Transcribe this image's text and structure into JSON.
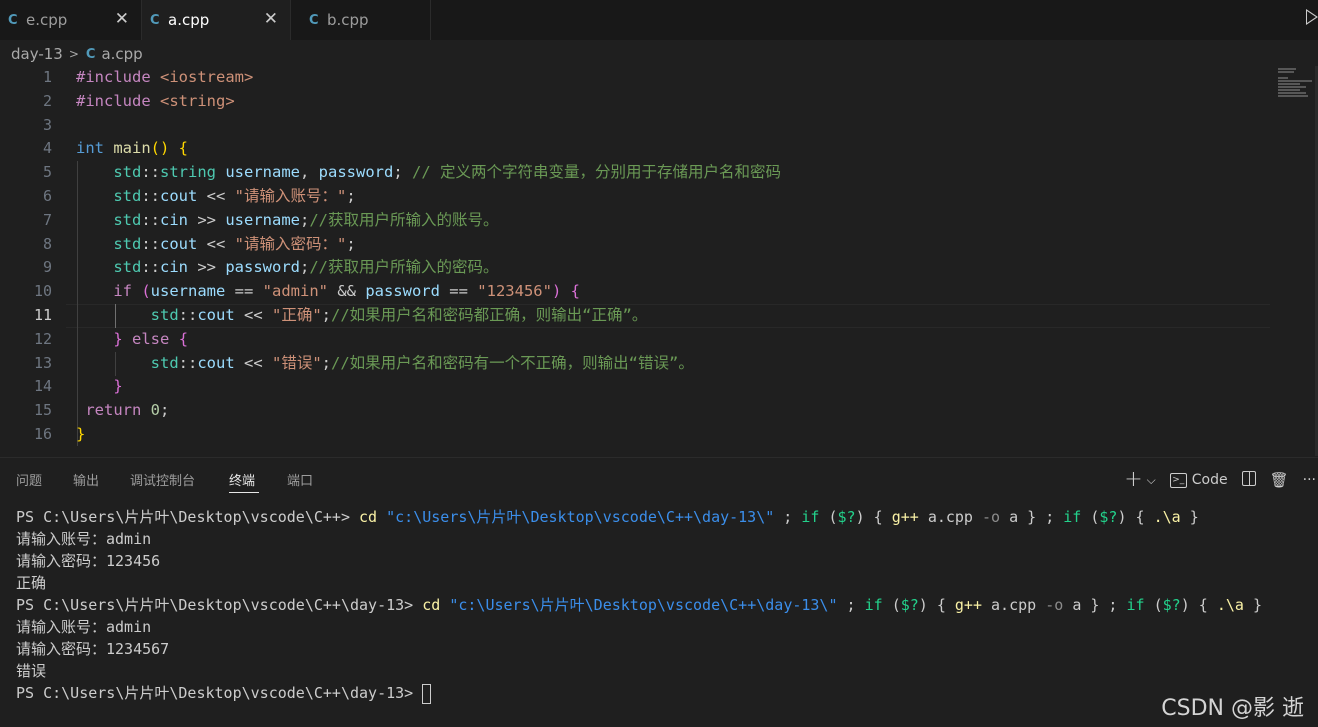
{
  "tabs": [
    {
      "icon": "C",
      "name": "e.cpp",
      "active": false
    },
    {
      "icon": "C",
      "name": "a.cpp",
      "active": true
    },
    {
      "icon": "C",
      "name": "b.cpp",
      "active": false
    }
  ],
  "tab_close_glyph": "✕",
  "breadcrumb": {
    "folder": "day-13",
    "separator": ">",
    "file": "a.cpp",
    "icon": "C"
  },
  "editor": {
    "line_numbers": [
      "1",
      "2",
      "3",
      "4",
      "5",
      "6",
      "7",
      "8",
      "9",
      "10",
      "11",
      "12",
      "13",
      "14",
      "15",
      "16"
    ],
    "current_line": "11",
    "lines": [
      [
        {
          "t": "#include ",
          "c": "k-inc"
        },
        {
          "t": "<iostream>",
          "c": "str"
        }
      ],
      [
        {
          "t": "#include ",
          "c": "k-inc"
        },
        {
          "t": "<string>",
          "c": "str"
        }
      ],
      [],
      [
        {
          "t": "int ",
          "c": "k-type"
        },
        {
          "t": "main",
          "c": "fn"
        },
        {
          "t": "() ",
          "c": "br1"
        },
        {
          "t": "{",
          "c": "br1"
        }
      ],
      [
        {
          "t": "    "
        },
        {
          "t": "std",
          "c": "ns"
        },
        {
          "t": "::"
        },
        {
          "t": "string",
          "c": "ns"
        },
        {
          "t": " "
        },
        {
          "t": "username",
          "c": "var"
        },
        {
          "t": ", "
        },
        {
          "t": "password",
          "c": "var"
        },
        {
          "t": "; "
        },
        {
          "t": "// 定义两个字符串变量，分别用于存储用户名和密码",
          "c": "cmt"
        }
      ],
      [
        {
          "t": "    "
        },
        {
          "t": "std",
          "c": "ns"
        },
        {
          "t": "::"
        },
        {
          "t": "cout",
          "c": "var"
        },
        {
          "t": " << "
        },
        {
          "t": "\"请输入账号：\"",
          "c": "str"
        },
        {
          "t": ";"
        }
      ],
      [
        {
          "t": "    "
        },
        {
          "t": "std",
          "c": "ns"
        },
        {
          "t": "::"
        },
        {
          "t": "cin",
          "c": "var"
        },
        {
          "t": " >> "
        },
        {
          "t": "username",
          "c": "var"
        },
        {
          "t": ";"
        },
        {
          "t": "//获取用户所输入的账号。",
          "c": "cmt"
        }
      ],
      [
        {
          "t": "    "
        },
        {
          "t": "std",
          "c": "ns"
        },
        {
          "t": "::"
        },
        {
          "t": "cout",
          "c": "var"
        },
        {
          "t": " << "
        },
        {
          "t": "\"请输入密码：\"",
          "c": "str"
        },
        {
          "t": ";"
        }
      ],
      [
        {
          "t": "    "
        },
        {
          "t": "std",
          "c": "ns"
        },
        {
          "t": "::"
        },
        {
          "t": "cin",
          "c": "var"
        },
        {
          "t": " >> "
        },
        {
          "t": "password",
          "c": "var"
        },
        {
          "t": ";"
        },
        {
          "t": "//获取用户所输入的密码。",
          "c": "cmt"
        }
      ],
      [
        {
          "t": "    "
        },
        {
          "t": "if ",
          "c": "k-ctrl"
        },
        {
          "t": "(",
          "c": "br2"
        },
        {
          "t": "username",
          "c": "var"
        },
        {
          "t": " == "
        },
        {
          "t": "\"admin\"",
          "c": "str"
        },
        {
          "t": " && "
        },
        {
          "t": "password",
          "c": "var"
        },
        {
          "t": " == "
        },
        {
          "t": "\"123456\"",
          "c": "str"
        },
        {
          "t": ")",
          "c": "br2"
        },
        {
          "t": " "
        },
        {
          "t": "{",
          "c": "br2"
        }
      ],
      [
        {
          "t": "        "
        },
        {
          "t": "std",
          "c": "ns"
        },
        {
          "t": "::"
        },
        {
          "t": "cout",
          "c": "var"
        },
        {
          "t": " << "
        },
        {
          "t": "\"正确\"",
          "c": "str"
        },
        {
          "t": ";"
        },
        {
          "t": "//如果用户名和密码都正确，则输出“正确”。",
          "c": "cmt"
        }
      ],
      [
        {
          "t": "    "
        },
        {
          "t": "}",
          "c": "br2"
        },
        {
          "t": " "
        },
        {
          "t": "else ",
          "c": "k-ctrl"
        },
        {
          "t": "{",
          "c": "br2"
        }
      ],
      [
        {
          "t": "        "
        },
        {
          "t": "std",
          "c": "ns"
        },
        {
          "t": "::"
        },
        {
          "t": "cout",
          "c": "var"
        },
        {
          "t": " << "
        },
        {
          "t": "\"错误\"",
          "c": "str"
        },
        {
          "t": ";"
        },
        {
          "t": "//如果用户名和密码有一个不正确，则输出“错误”。",
          "c": "cmt"
        }
      ],
      [
        {
          "t": "    "
        },
        {
          "t": "}",
          "c": "br2"
        }
      ],
      [
        {
          "t": " "
        },
        {
          "t": "return ",
          "c": "k-ctrl"
        },
        {
          "t": "0",
          "c": "num"
        },
        {
          "t": ";"
        }
      ],
      [
        {
          "t": "}",
          "c": "br1"
        }
      ]
    ]
  },
  "panel": {
    "tabs": [
      {
        "label": "问题",
        "active": false
      },
      {
        "label": "输出",
        "active": false
      },
      {
        "label": "调试控制台",
        "active": false
      },
      {
        "label": "终端",
        "active": true
      },
      {
        "label": "端口",
        "active": false
      }
    ],
    "actions": {
      "plus": "+",
      "dropdown": "⌵",
      "code_label": "Code",
      "more": "···"
    }
  },
  "terminal": {
    "lines": [
      [
        {
          "t": "PS C:\\Users\\片片叶\\Desktop\\vscode\\C++> "
        },
        {
          "t": "cd ",
          "c": "t-cmd"
        },
        {
          "t": "\"c:\\Users\\片片叶\\Desktop\\vscode\\C++\\day-13\\\"",
          "c": "t-str"
        },
        {
          "t": " ; "
        },
        {
          "t": "if ",
          "c": "t-kw"
        },
        {
          "t": "("
        },
        {
          "t": "$?",
          "c": "t-kw"
        },
        {
          "t": ") { "
        },
        {
          "t": "g++ ",
          "c": "t-cmd"
        },
        {
          "t": "a.cpp "
        },
        {
          "t": "-o ",
          "c": "t-op"
        },
        {
          "t": "a } ; "
        },
        {
          "t": "if ",
          "c": "t-kw"
        },
        {
          "t": "("
        },
        {
          "t": "$?",
          "c": "t-kw"
        },
        {
          "t": ") { "
        },
        {
          "t": ".\\a ",
          "c": "t-cmd"
        },
        {
          "t": "}"
        }
      ],
      [
        {
          "t": "请输入账号：admin"
        }
      ],
      [
        {
          "t": "请输入密码：123456"
        }
      ],
      [
        {
          "t": "正确"
        }
      ],
      [
        {
          "t": "PS C:\\Users\\片片叶\\Desktop\\vscode\\C++\\day-13> "
        },
        {
          "t": "cd ",
          "c": "t-cmd"
        },
        {
          "t": "\"c:\\Users\\片片叶\\Desktop\\vscode\\C++\\day-13\\\"",
          "c": "t-str"
        },
        {
          "t": " ; "
        },
        {
          "t": "if ",
          "c": "t-kw"
        },
        {
          "t": "("
        },
        {
          "t": "$?",
          "c": "t-kw"
        },
        {
          "t": ") { "
        },
        {
          "t": "g++ ",
          "c": "t-cmd"
        },
        {
          "t": "a.cpp "
        },
        {
          "t": "-o ",
          "c": "t-op"
        },
        {
          "t": "a } ; "
        },
        {
          "t": "if ",
          "c": "t-kw"
        },
        {
          "t": "("
        },
        {
          "t": "$?",
          "c": "t-kw"
        },
        {
          "t": ") { "
        },
        {
          "t": ".\\a ",
          "c": "t-cmd"
        },
        {
          "t": "}"
        }
      ],
      [
        {
          "t": "请输入账号：admin"
        }
      ],
      [
        {
          "t": "请输入密码：1234567"
        }
      ],
      [
        {
          "t": "错误"
        }
      ],
      [
        {
          "t": "PS C:\\Users\\片片叶\\Desktop\\vscode\\C++\\day-13> "
        }
      ]
    ]
  },
  "watermark": "CSDN @影 逝",
  "colors": {
    "comment": "#6a9955",
    "string": "#ce9178",
    "keyword": "#c586c0",
    "type": "#569cd6",
    "accent": "#519aba"
  }
}
